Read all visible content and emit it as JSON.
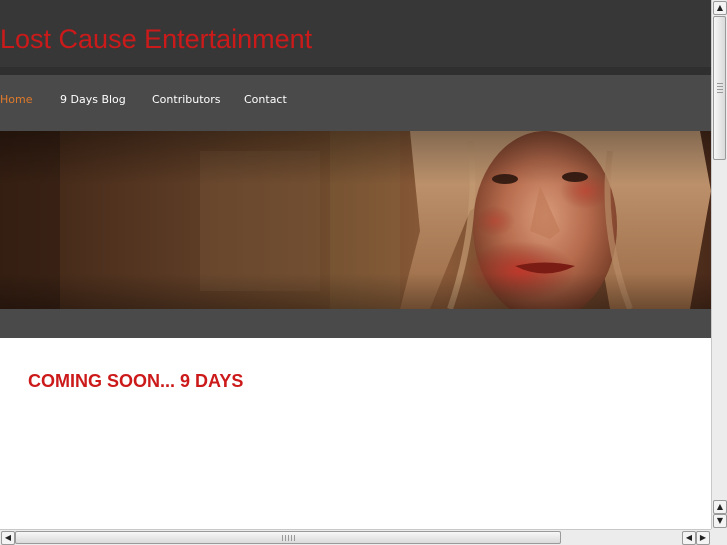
{
  "site": {
    "title": "Lost Cause Entertainment"
  },
  "nav": {
    "items": [
      {
        "label": "Home",
        "active": true
      },
      {
        "label": "9 Days Blog",
        "active": false
      },
      {
        "label": "Contributors",
        "active": false
      },
      {
        "label": "Contact",
        "active": false
      }
    ]
  },
  "hero": {
    "image": "woman-face-blood-image"
  },
  "content": {
    "heading": "COMING SOON... 9 DAYS"
  },
  "colors": {
    "accent": "#cc1a1a",
    "nav_active": "#e07a2a",
    "nav_text": "#ffffff",
    "header_bg": "#373737",
    "nav_bg": "#4a4a4a"
  },
  "icons": {
    "scroll_up": "scroll-up-arrow-icon",
    "scroll_down": "scroll-down-arrow-icon",
    "scroll_left": "scroll-left-arrow-icon",
    "scroll_right": "scroll-right-arrow-icon"
  }
}
